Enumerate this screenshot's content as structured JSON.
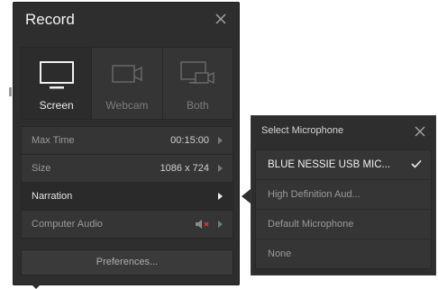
{
  "record": {
    "title": "Record",
    "modes": [
      {
        "label": "Screen",
        "icon": "monitor-icon",
        "active": true
      },
      {
        "label": "Webcam",
        "icon": "webcam-icon",
        "active": false
      },
      {
        "label": "Both",
        "icon": "screen-webcam-icon",
        "active": false
      }
    ],
    "settings": [
      {
        "name": "Max Time",
        "value": "00:15:00"
      },
      {
        "name": "Size",
        "value": "1086 x 724"
      },
      {
        "name": "Narration",
        "value": ""
      },
      {
        "name": "Computer Audio",
        "value": "",
        "icon": "speaker-muted-icon"
      }
    ],
    "preferences_label": "Preferences..."
  },
  "microphone": {
    "title": "Select Microphone",
    "options": [
      {
        "label": "BLUE NESSIE USB MIC...",
        "selected": true
      },
      {
        "label": "High Definition Aud...",
        "selected": false
      },
      {
        "label": "Default Microphone",
        "selected": false
      },
      {
        "label": "None",
        "selected": false
      }
    ]
  },
  "colors": {
    "panel_bg": "#2e2e2e",
    "row_bg": "#353535",
    "text_active": "#f0f0f0",
    "text_muted": "#9a9a9a",
    "mute_red": "#d83a3a"
  }
}
